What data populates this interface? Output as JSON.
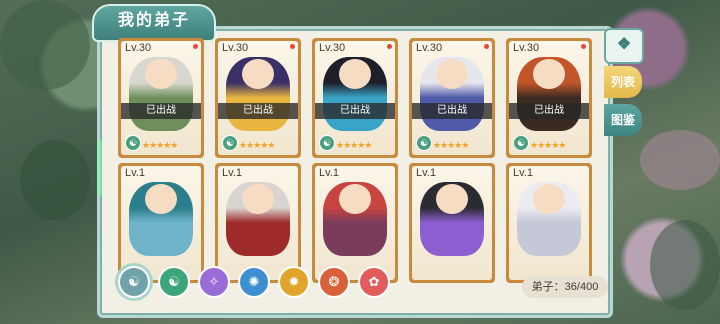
{
  "panel": {
    "title": "我的弟子"
  },
  "cards": [
    {
      "level": "Lv.30",
      "deployed": "已出战",
      "stars": "★★★★★",
      "badge": "☯",
      "hair": "#d8d8d0",
      "outfit": "#6f8f5a"
    },
    {
      "level": "Lv.30",
      "deployed": "已出战",
      "stars": "★★★★★",
      "badge": "☯",
      "hair": "#3b2f67",
      "outfit": "#e8b63e"
    },
    {
      "level": "Lv.30",
      "deployed": "已出战",
      "stars": "★★★★★",
      "badge": "☯",
      "hair": "#1f1f2a",
      "outfit": "#3aa3c8"
    },
    {
      "level": "Lv.30",
      "deployed": "已出战",
      "stars": "★★★★★",
      "badge": "☯",
      "hair": "#e6e6ef",
      "outfit": "#4f5aa8"
    },
    {
      "level": "Lv.30",
      "deployed": "已出战",
      "stars": "★★★★★",
      "badge": "☯",
      "hair": "#c2562b",
      "outfit": "#3a2a22"
    },
    {
      "level": "Lv.1",
      "deployed": "",
      "stars": "",
      "badge": "",
      "hair": "#2b7f8c",
      "outfit": "#6fb3c9"
    },
    {
      "level": "Lv.1",
      "deployed": "",
      "stars": "",
      "badge": "",
      "hair": "#d8d4d0",
      "outfit": "#9e2a2a"
    },
    {
      "level": "Lv.1",
      "deployed": "",
      "stars": "",
      "badge": "",
      "hair": "#c8443f",
      "outfit": "#7a3c5a"
    },
    {
      "level": "Lv.1",
      "deployed": "",
      "stars": "",
      "badge": "",
      "hair": "#2b2b33",
      "outfit": "#8b5fd0"
    },
    {
      "level": "Lv.1",
      "deployed": "",
      "stars": "",
      "badge": "",
      "hair": "#ecebf2",
      "outfit": "#c5c8d6"
    }
  ],
  "tabs": {
    "top_icon": "❖",
    "list": "列表",
    "guide": "图鉴"
  },
  "filters": [
    {
      "glyph": "☯",
      "color": "#6fa3a9"
    },
    {
      "glyph": "☯",
      "color": "#3da57a"
    },
    {
      "glyph": "✧",
      "color": "#9a6cd6"
    },
    {
      "glyph": "✺",
      "color": "#3e8fd0"
    },
    {
      "glyph": "✹",
      "color": "#e0a52a"
    },
    {
      "glyph": "❂",
      "color": "#d8613a"
    },
    {
      "glyph": "✿",
      "color": "#e35c5c"
    }
  ],
  "count": "弟子：36/400"
}
